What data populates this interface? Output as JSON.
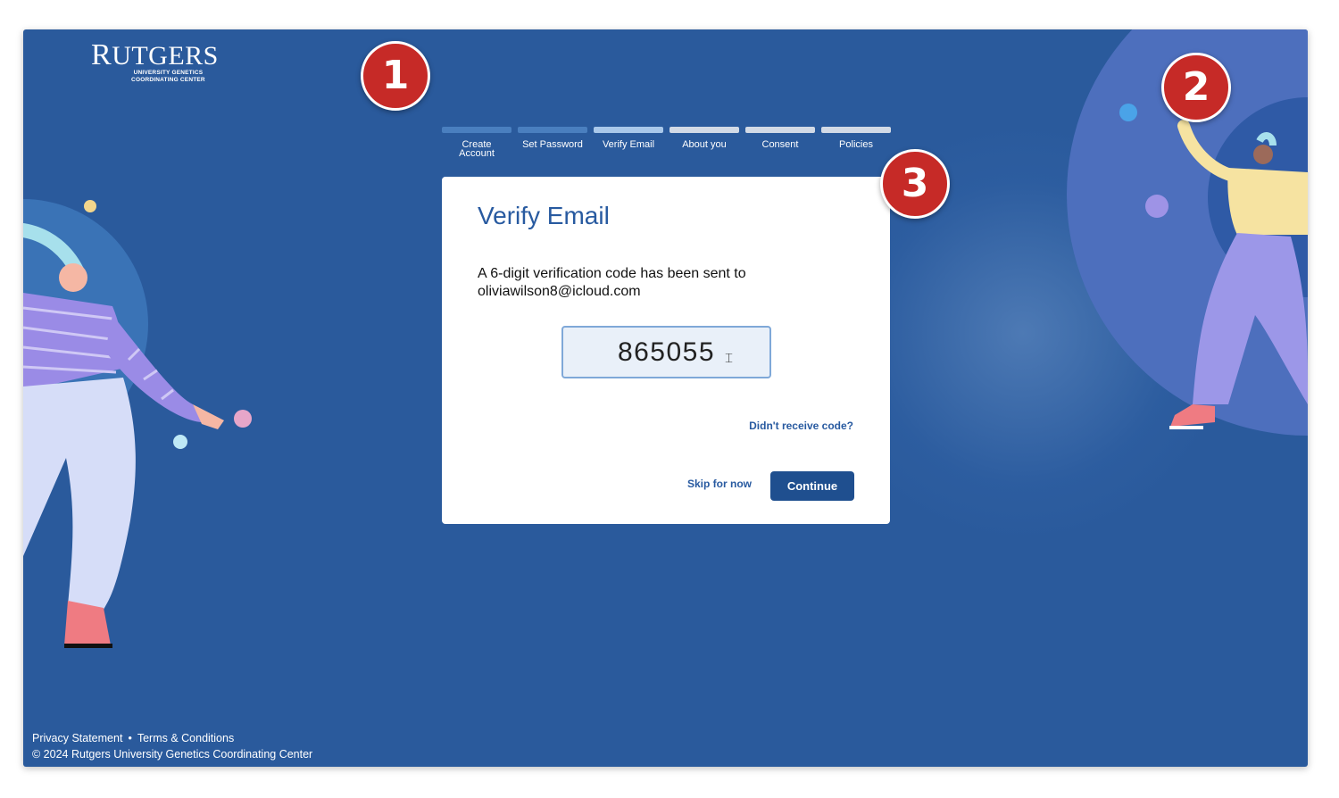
{
  "brand": {
    "logo_word_initial": "R",
    "logo_word_rest": "UTGERS",
    "logo_sub_line1": "UNIVERSITY GENETICS",
    "logo_sub_line2": "COORDINATING CENTER"
  },
  "stepper": {
    "steps": [
      {
        "line1": "Create",
        "line2": "Account",
        "state": "done"
      },
      {
        "line1": "Set Password",
        "line2": "",
        "state": "done"
      },
      {
        "line1": "Verify Email",
        "line2": "",
        "state": "current"
      },
      {
        "line1": "About you",
        "line2": "",
        "state": "upcoming"
      },
      {
        "line1": "Consent",
        "line2": "",
        "state": "upcoming"
      },
      {
        "line1": "Policies",
        "line2": "",
        "state": "upcoming"
      }
    ]
  },
  "card": {
    "title": "Verify Email",
    "message_line1": "A 6-digit verification code has been sent to",
    "message_line2": "oliviawilson8@icloud.com",
    "code_value": "865055",
    "resend_label": "Didn't receive code?",
    "skip_label": "Skip for now",
    "continue_label": "Continue"
  },
  "footer": {
    "privacy_label": "Privacy Statement",
    "separator": "•",
    "terms_label": "Terms & Conditions",
    "copyright": "© 2024 Rutgers University Genetics Coordinating Center"
  },
  "callouts": [
    "1",
    "2",
    "3"
  ],
  "colors": {
    "background": "#2a5a9c",
    "primary": "#1f4f8f",
    "title": "#285aa0",
    "callout": "#c62a27"
  },
  "icons": {
    "text_cursor": "i-beam-cursor-icon"
  }
}
